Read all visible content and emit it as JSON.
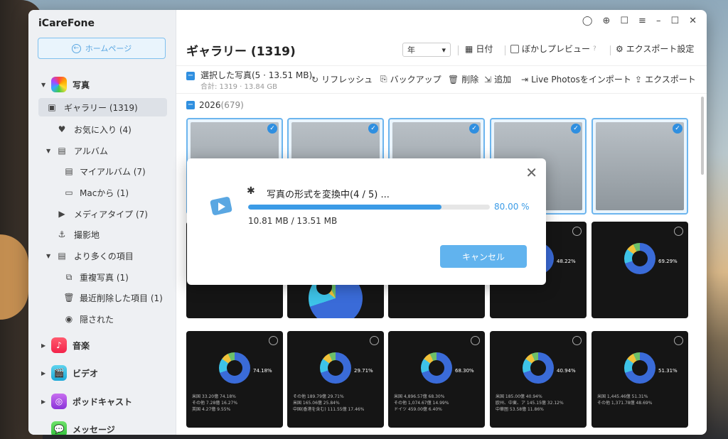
{
  "app": {
    "name": "iCareFone",
    "home_label": "ホームページ"
  },
  "sidebar": {
    "photos": "写真",
    "gallery": "ギャラリー (1319)",
    "favorites": "お気に入り (4)",
    "albums": "アルバム",
    "my_albums": "マイアルバム (7)",
    "from_mac": "Macから (1)",
    "media_types": "メディアタイプ (7)",
    "places": "撮影地",
    "more_items": "より多くの項目",
    "duplicates": "重複写真 (1)",
    "recently_deleted": "最近削除した項目 (1)",
    "hidden": "隠された",
    "music": "音楽",
    "video": "ビデオ",
    "podcast": "ポッドキャスト",
    "messages": "メッセージ"
  },
  "header": {
    "title": "ギャラリー (1319)",
    "period_select": "年",
    "date_label": "日付",
    "blur_preview": "ぼかしプレビュー",
    "export_settings": "エクスポート設定"
  },
  "actionbar": {
    "selected": "選択した写真(5 · 13.51 MB)",
    "total": "合計: 1319 · 13.84 GB",
    "refresh": "リフレッシュ",
    "backup": "バックアップ",
    "delete": "削除",
    "add": "追加",
    "live_import": "Live Photosをインポート",
    "export": "エクスポート"
  },
  "section": {
    "year": "2026",
    "count": "(679)"
  },
  "charts": {
    "pcts": [
      "74.18%",
      "29.71%",
      "68.30%",
      "40.94%",
      "51.31%",
      "48.22%",
      "69.29%"
    ],
    "rows_a": [
      "米国  33.20億  74.18%",
      "その他  7.28億  16.27%",
      "英国  4.27億  9.55%"
    ],
    "rows_b": [
      "その他  189.79億  29.71%",
      "米国  165.06億  25.84%",
      "中国(香港を含む)  111.55億  17.46%"
    ],
    "rows_c": [
      "米国  4,896.57億  68.30%",
      "その他  1,074.67億  14.99%",
      "ドイツ  459.00億  6.40%"
    ],
    "rows_d": [
      "米国  185.00億  40.94%",
      "欧州、中東、ア  145.15億  32.12%",
      "中華圏  53.58億  11.86%"
    ],
    "rows_e": [
      "米国  1,445.46億  51.31%",
      "その他  1,371.78億  48.69%"
    ]
  },
  "dialog": {
    "message": "写真の形式を変換中(4 / 5) ...",
    "progress": 80,
    "progress_text": "80.00 %",
    "size_text": "10.81 MB / 13.51 MB",
    "cancel": "キャンセル"
  }
}
